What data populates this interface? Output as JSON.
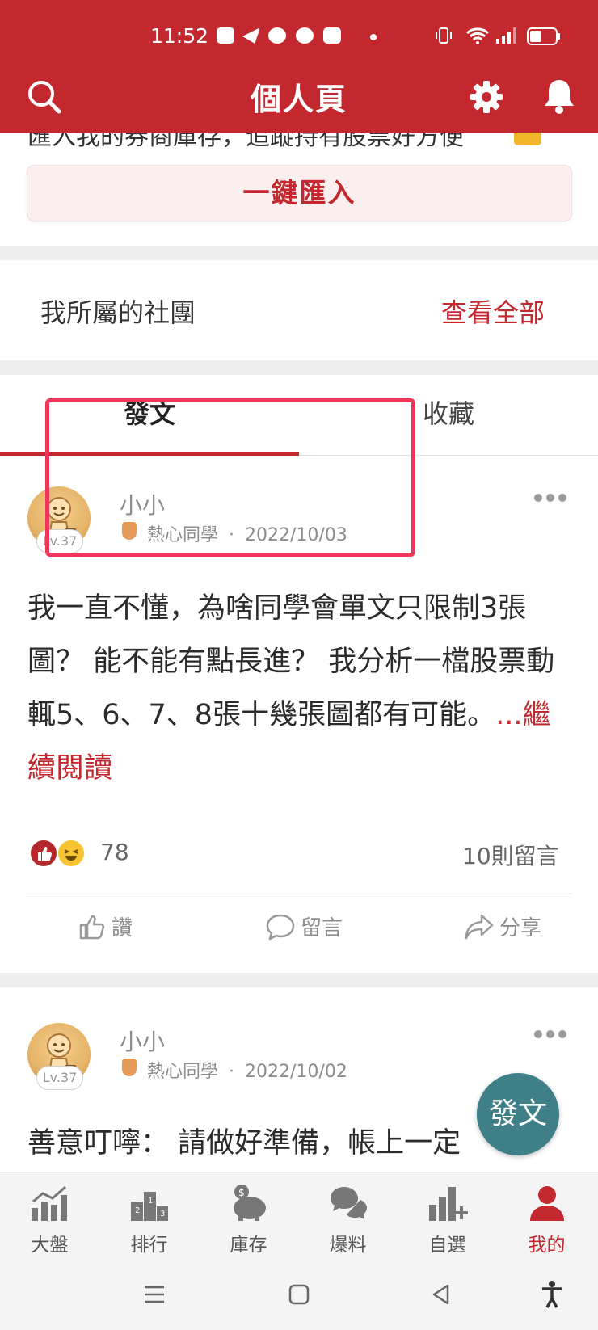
{
  "status_bar": {
    "time": "11:52"
  },
  "header": {
    "title": "個人頁",
    "icons": [
      "search-icon",
      "gear-icon",
      "bell-icon"
    ]
  },
  "import_card": {
    "partial_text": "匯入我的券商庫存，追蹤持有股票好方便",
    "button_label": "一鍵匯入"
  },
  "clubs": {
    "title": "我所屬的社團",
    "view_all": "查看全部"
  },
  "tabs": [
    {
      "label": "發文",
      "active": true
    },
    {
      "label": "收藏",
      "active": false
    }
  ],
  "posts": [
    {
      "author": "小小",
      "badge": "熱心同學",
      "separator": "·",
      "date": "2022/10/03",
      "level": "Lv.37",
      "body": "我一直不懂，為啥同學會單文只限制3張圖？ 能不能有點長進？ 我分析一檔股票動輒5、6、7、8張十幾張圖都有可能。",
      "more": "...繼續閱讀",
      "reaction_count": "78",
      "comments": "10則留言",
      "actions": [
        "讚",
        "留言",
        "分享"
      ]
    },
    {
      "author": "小小",
      "badge": "熱心同學",
      "separator": "·",
      "date": "2022/10/02",
      "level": "Lv.37",
      "body": "善意叮嚀： 請做好準備，帳上一定"
    }
  ],
  "fab": {
    "label": "發文"
  },
  "bottom_nav": [
    {
      "label": "大盤",
      "icon": "market-chart-icon",
      "active": false
    },
    {
      "label": "排行",
      "icon": "podium-icon",
      "active": false
    },
    {
      "label": "庫存",
      "icon": "piggy-bank-icon",
      "active": false
    },
    {
      "label": "爆料",
      "icon": "chat-bubbles-icon",
      "active": false
    },
    {
      "label": "自選",
      "icon": "bar-plus-icon",
      "active": false
    },
    {
      "label": "我的",
      "icon": "person-icon",
      "active": true
    }
  ],
  "colors": {
    "brand": "#c3282e",
    "fab": "#3f7f87",
    "highlight": "#f0365a"
  }
}
